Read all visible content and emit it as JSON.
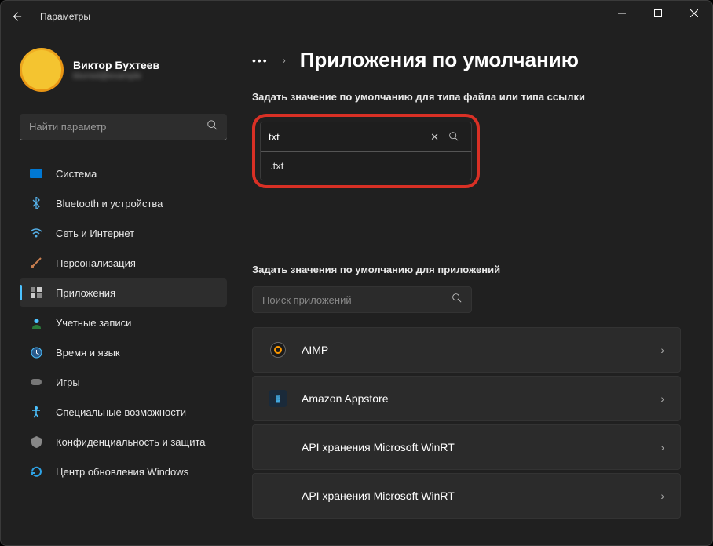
{
  "window": {
    "title": "Параметры"
  },
  "profile": {
    "name": "Виктор Бухтеев",
    "email": "blurred@example"
  },
  "sidebar_search": {
    "placeholder": "Найти параметр"
  },
  "nav": [
    {
      "label": "Система"
    },
    {
      "label": "Bluetooth и устройства"
    },
    {
      "label": "Сеть и Интернет"
    },
    {
      "label": "Персонализация"
    },
    {
      "label": "Приложения"
    },
    {
      "label": "Учетные записи"
    },
    {
      "label": "Время и язык"
    },
    {
      "label": "Игры"
    },
    {
      "label": "Специальные возможности"
    },
    {
      "label": "Конфиденциальность и защита"
    },
    {
      "label": "Центр обновления Windows"
    }
  ],
  "page": {
    "title": "Приложения по умолчанию",
    "section1": "Задать значение по умолчанию для типа файла или типа ссылки",
    "section2": "Задать значения по умолчанию для приложений"
  },
  "filetype": {
    "value": "txt",
    "suggestion": ".txt"
  },
  "appsearch": {
    "placeholder": "Поиск приложений"
  },
  "apps": [
    {
      "name": "AIMP"
    },
    {
      "name": "Amazon Appstore"
    },
    {
      "name": "API хранения Microsoft WinRT"
    },
    {
      "name": "API хранения Microsoft WinRT"
    }
  ]
}
